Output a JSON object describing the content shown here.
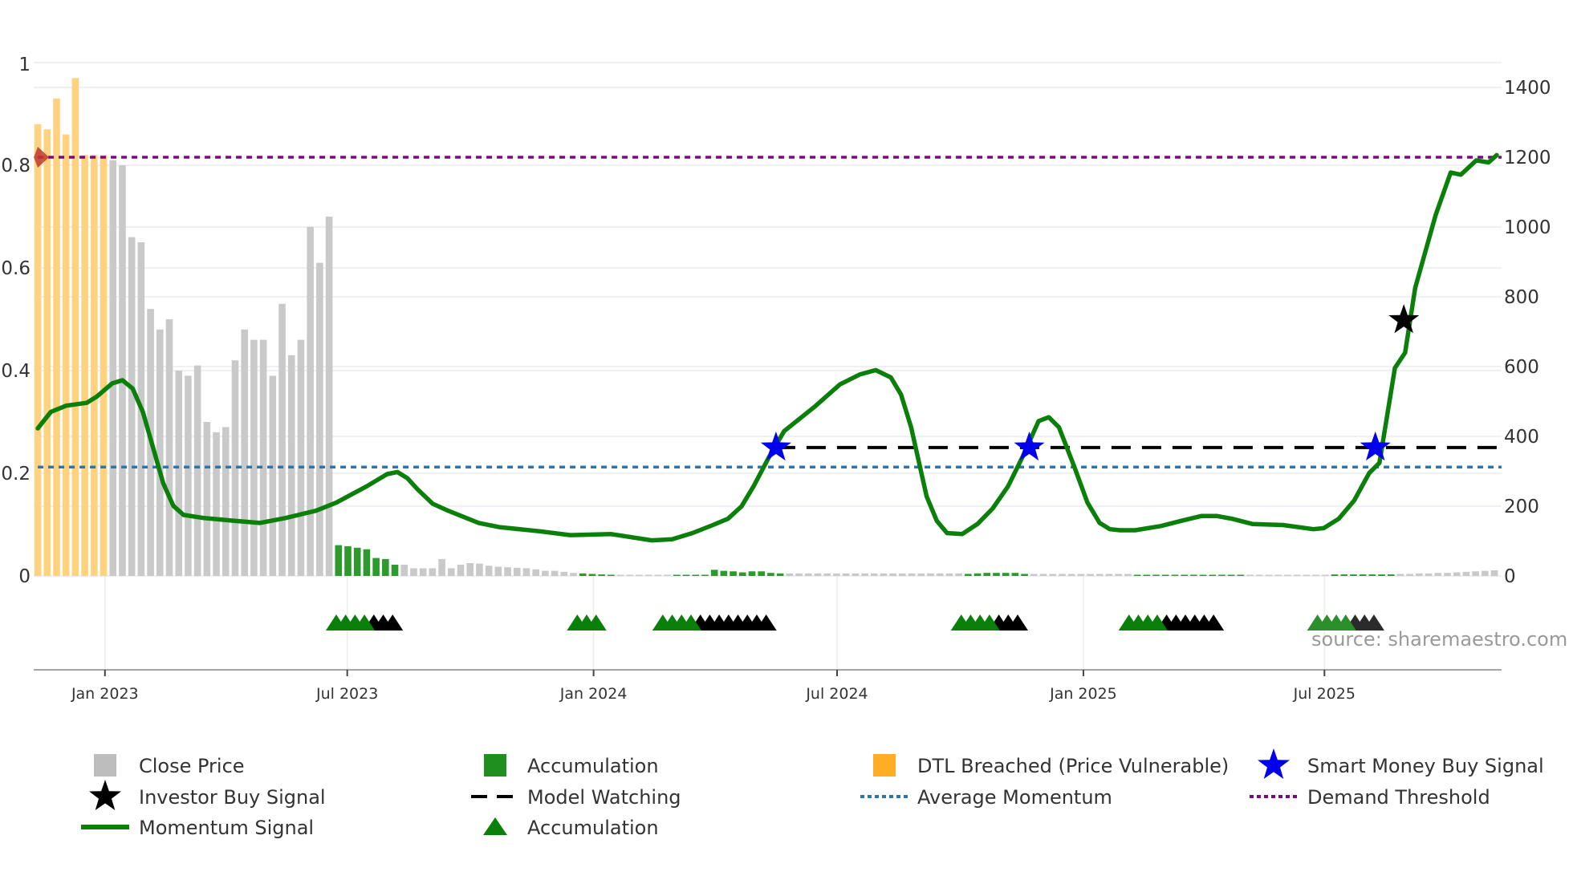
{
  "chart_data": {
    "type": "bar+line",
    "x_unit": "months since Jan 2023",
    "xlim": [
      -1.75,
      34.3
    ],
    "left_axis": {
      "ylim": [
        0,
        1
      ],
      "ticks": [
        "0",
        "0.2",
        "0.4",
        "0.6",
        "0.8",
        "1"
      ],
      "tick_values": [
        0,
        0.2,
        0.4,
        0.6,
        0.8,
        1
      ]
    },
    "right_axis": {
      "ylim": [
        0,
        1400
      ],
      "ticks": [
        "0",
        "200",
        "400",
        "600",
        "800",
        "1000",
        "1200",
        "1400"
      ],
      "tick_values": [
        0,
        200,
        400,
        600,
        800,
        1000,
        1200,
        1400
      ]
    },
    "x_ticks": [
      {
        "label": "Jan 2023",
        "value": 0
      },
      {
        "label": "Jul 2023",
        "value": 5.95
      },
      {
        "label": "Jan 2024",
        "value": 12.0
      },
      {
        "label": "Jul 2024",
        "value": 17.98
      },
      {
        "label": "Jan 2025",
        "value": 24.03
      },
      {
        "label": "Jul 2025",
        "value": 29.95
      }
    ],
    "grid": true,
    "bars": {
      "x_start": -1.65,
      "x_step": 0.2308,
      "values": [
        0.88,
        0.87,
        0.93,
        0.86,
        0.97,
        0.82,
        0.82,
        0.82,
        0.81,
        0.8,
        0.66,
        0.65,
        0.52,
        0.48,
        0.5,
        0.4,
        0.39,
        0.41,
        0.3,
        0.28,
        0.29,
        0.42,
        0.48,
        0.46,
        0.46,
        0.39,
        0.53,
        0.43,
        0.46,
        0.68,
        0.61,
        0.7,
        0.06,
        0.058,
        0.055,
        0.052,
        0.035,
        0.033,
        0.022,
        0.022,
        0.015,
        0.015,
        0.015,
        0.033,
        0.015,
        0.022,
        0.025,
        0.024,
        0.02,
        0.018,
        0.017,
        0.016,
        0.015,
        0.013,
        0.01,
        0.01,
        0.008,
        0.006,
        0.005,
        0.004,
        0.003,
        0.002,
        0.001,
        0.001,
        0.001,
        0.001,
        0.001,
        0.001,
        0.001,
        0.001,
        0.001,
        0.001,
        0.012,
        0.01,
        0.009,
        0.007,
        0.009,
        0.009,
        0.006,
        0.005,
        0.005,
        0.005,
        0.005,
        0.005,
        0.005,
        0.005,
        0.005,
        0.005,
        0.005,
        0.005,
        0.005,
        0.005,
        0.005,
        0.005,
        0.005,
        0.005,
        0.005,
        0.005,
        0.005,
        0.004,
        0.005,
        0.006,
        0.006,
        0.006,
        0.006,
        0.004,
        0.004,
        0.004,
        0.004,
        0.004,
        0.004,
        0.004,
        0.004,
        0.004,
        0.004,
        0.004,
        0.004,
        0.002,
        0.002,
        0.002,
        0.002,
        0.002,
        0.002,
        0.002,
        0.002,
        0.002,
        0.002,
        0.002,
        0.002,
        0.001,
        0.001,
        0.001,
        0.001,
        0.001,
        0.001,
        0.001,
        0.001,
        0.001,
        0.003,
        0.003,
        0.003,
        0.003,
        0.003,
        0.003,
        0.003,
        0.004,
        0.004,
        0.005,
        0.005,
        0.006,
        0.006,
        0.007,
        0.008,
        0.009,
        0.01,
        0.011
      ],
      "categories": [
        "dtl",
        "dtl",
        "dtl",
        "dtl",
        "dtl",
        "dtl",
        "dtl",
        "dtl",
        "close",
        "close",
        "close",
        "close",
        "close",
        "close",
        "close",
        "close",
        "close",
        "close",
        "close",
        "close",
        "close",
        "close",
        "close",
        "close",
        "close",
        "close",
        "close",
        "close",
        "close",
        "close",
        "close",
        "close",
        "acc",
        "acc",
        "acc",
        "acc",
        "acc",
        "acc",
        "acc",
        "close",
        "close",
        "close",
        "close",
        "close",
        "close",
        "close",
        "close",
        "close",
        "close",
        "close",
        "close",
        "close",
        "close",
        "close",
        "close",
        "close",
        "close",
        "close",
        "acc",
        "acc",
        "acc",
        "acc",
        "close",
        "close",
        "close",
        "close",
        "close",
        "close",
        "acc",
        "acc",
        "acc",
        "acc",
        "acc",
        "acc",
        "acc",
        "acc",
        "acc",
        "acc",
        "acc",
        "acc",
        "close",
        "close",
        "close",
        "close",
        "close",
        "close",
        "close",
        "close",
        "close",
        "close",
        "close",
        "close",
        "close",
        "close",
        "close",
        "close",
        "close",
        "close",
        "close",
        "acc",
        "acc",
        "acc",
        "acc",
        "acc",
        "acc",
        "acc",
        "close",
        "close",
        "close",
        "close",
        "close",
        "close",
        "close",
        "close",
        "close",
        "close",
        "close",
        "acc",
        "acc",
        "acc",
        "acc",
        "acc",
        "acc",
        "acc",
        "acc",
        "acc",
        "acc",
        "acc",
        "acc",
        "close",
        "close",
        "close",
        "close",
        "close",
        "close",
        "close",
        "close",
        "close",
        "acc",
        "acc",
        "acc",
        "acc",
        "acc",
        "acc",
        "acc",
        "close",
        "close",
        "close",
        "close",
        "close",
        "close",
        "close",
        "close",
        "close",
        "close",
        "close"
      ]
    },
    "momentum": {
      "x": [
        -1.65,
        -1.33,
        -0.95,
        -0.45,
        -0.2,
        0.18,
        0.43,
        0.68,
        0.93,
        1.18,
        1.43,
        1.68,
        1.93,
        2.43,
        3.18,
        3.8,
        4.43,
        5.18,
        5.68,
        6.43,
        6.93,
        7.18,
        7.43,
        7.68,
        8.05,
        8.43,
        9.18,
        9.68,
        10.68,
        11.43,
        12.43,
        13.43,
        13.93,
        14.43,
        14.93,
        15.3,
        15.63,
        15.93,
        16.3,
        16.68,
        17.43,
        18.05,
        18.55,
        18.93,
        19.3,
        19.55,
        19.8,
        20.18,
        20.43,
        20.68,
        21.05,
        21.43,
        21.8,
        22.18,
        22.55,
        22.93,
        23.18,
        23.43,
        23.8,
        24.13,
        24.43,
        24.68,
        24.93,
        25.3,
        25.93,
        26.43,
        26.93,
        27.3,
        27.68,
        28.18,
        28.93,
        29.68,
        29.93,
        30.3,
        30.68,
        31.05,
        31.3,
        31.68,
        31.93,
        32.18,
        32.68,
        33.05,
        33.3,
        33.68,
        33.98,
        34.18
      ],
      "y": [
        423,
        470,
        488,
        496,
        514,
        552,
        561,
        537,
        470,
        368,
        266,
        201,
        175,
        166,
        158,
        152,
        166,
        187,
        210,
        257,
        292,
        298,
        280,
        248,
        207,
        187,
        152,
        140,
        128,
        117,
        120,
        102,
        105,
        123,
        146,
        164,
        199,
        257,
        339,
        415,
        485,
        549,
        578,
        590,
        569,
        520,
        426,
        228,
        158,
        123,
        120,
        149,
        193,
        257,
        345,
        444,
        455,
        426,
        315,
        210,
        152,
        134,
        131,
        131,
        143,
        158,
        172,
        172,
        164,
        149,
        146,
        134,
        137,
        164,
        216,
        295,
        324,
        596,
        640,
        826,
        1034,
        1156,
        1150,
        1191,
        1185,
        1206
      ]
    },
    "demand_threshold": 1200,
    "average_momentum": 312,
    "model_watching": {
      "value": 368,
      "x_from": 16.48,
      "x_to": 34.2
    },
    "smart_money_buy_signals": [
      {
        "x": 16.48,
        "y": 368
      },
      {
        "x": 22.7,
        "y": 368
      },
      {
        "x": 31.2,
        "y": 368
      }
    ],
    "investor_buy_signals": [
      {
        "x": 31.9,
        "y": 733
      }
    ],
    "accumulation_markers": {
      "step": 0.2308,
      "groups": [
        {
          "start": 5.68,
          "green": 4,
          "black": 3
        },
        {
          "start": 11.6,
          "green": 3,
          "black": 0
        },
        {
          "start": 13.7,
          "green": 4,
          "black": 8
        },
        {
          "start": 21.03,
          "green": 4,
          "black": 3
        },
        {
          "start": 25.15,
          "green": 4,
          "black": 6
        },
        {
          "start": 29.78,
          "green": 4,
          "black": 3
        }
      ]
    },
    "legend": [
      {
        "label": "Close Price",
        "marker": "square",
        "color": "#bdbdbd"
      },
      {
        "label": "Accumulation",
        "marker": "square",
        "color": "#1f8f1f"
      },
      {
        "label": "DTL Breached (Price Vulnerable)",
        "marker": "square",
        "color": "#ffad24"
      },
      {
        "label": "Smart Money Buy Signal",
        "marker": "star",
        "color": "#0000ee"
      },
      {
        "label": "Investor Buy Signal",
        "marker": "star",
        "color": "#000000"
      },
      {
        "label": "Model Watching",
        "marker": "dash",
        "color": "#000000"
      },
      {
        "label": "Average Momentum",
        "marker": "dot",
        "color": "#2a77b0"
      },
      {
        "label": "Demand Threshold",
        "marker": "dot",
        "color": "#7a0a7a"
      },
      {
        "label": "Momentum Signal",
        "marker": "line",
        "color": "#0a7f0a"
      },
      {
        "label": "Accumulation",
        "marker": "triangle",
        "color": "#0a7f0a"
      }
    ],
    "legend_placement": "bottom",
    "source": "source: sharemaestro.com"
  }
}
